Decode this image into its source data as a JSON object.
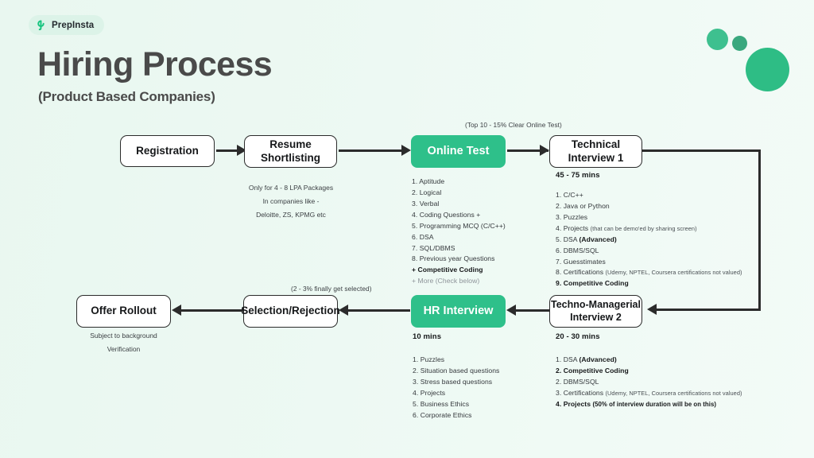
{
  "brand": {
    "logo_icon": "prepinsta-p-logo-icon",
    "name": "PrepInsta"
  },
  "header": {
    "title": "Hiring Process",
    "subtitle": "(Product Based Companies)"
  },
  "colors": {
    "accent_green": "#2ec08a",
    "deco_green_light": "#3ec08f",
    "deco_green_dark": "#3aa87e",
    "background": "#ecf8f2",
    "line": "#2b2b2b"
  },
  "nodes": {
    "registration": {
      "label": "Registration"
    },
    "resume_shortlisting": {
      "label": "Resume\nShortlisting"
    },
    "online_test": {
      "label": "Online Test"
    },
    "technical_interview_1": {
      "label": "Technical\nInterview 1"
    },
    "techno_managerial_interview_2": {
      "label": "Techno-Managerial\nInterview 2"
    },
    "hr_interview": {
      "label": "HR Interview"
    },
    "selection_rejection": {
      "label": "Selection/Rejection"
    },
    "offer_rollout": {
      "label": "Offer Rollout"
    }
  },
  "annotations": {
    "online_test_top": "(Top 10 - 15% Clear Online Test)",
    "selection_top": "(2 - 3% finally get selected)",
    "resume_note_line1": "Only for 4 - 8 LPA Packages",
    "resume_note_line2": "In companies like -",
    "resume_note_line3": "Deloitte, ZS, KPMG etc",
    "offer_note_line1": "Subject to background",
    "offer_note_line2": "Verification"
  },
  "durations": {
    "technical_interview_1": "45 - 75 mins",
    "techno_managerial_interview_2": "20 - 30 mins",
    "hr_interview": "10 mins"
  },
  "lists": {
    "online_test": [
      {
        "text": "1. Aptitude",
        "style": "normal"
      },
      {
        "text": "2. Logical",
        "style": "normal"
      },
      {
        "text": "3. Verbal",
        "style": "normal"
      },
      {
        "text": "4. Coding Questions +",
        "style": "normal"
      },
      {
        "text": "5. Programming MCQ (C/C++)",
        "style": "normal"
      },
      {
        "text": "6. DSA",
        "style": "normal"
      },
      {
        "text": "7. SQL/DBMS",
        "style": "normal"
      },
      {
        "text": "8. Previous year Questions",
        "style": "normal"
      },
      {
        "text": "+ Competitive Coding",
        "style": "bold"
      },
      {
        "text": "+ More (Check below)",
        "style": "muted"
      }
    ],
    "technical_interview_1": [
      {
        "text": "1. C/C++",
        "style": "normal"
      },
      {
        "text": "2. Java or Python",
        "style": "normal"
      },
      {
        "text": "3. Puzzles",
        "style": "normal"
      },
      {
        "text": "4. Projects ",
        "sub": "(that can be demo'ed by sharing screen)",
        "style": "normal"
      },
      {
        "text": "5. DSA ",
        "strong": "(Advanced)",
        "style": "normal"
      },
      {
        "text": "6. DBMS/SQL",
        "style": "normal"
      },
      {
        "text": "7. Guesstimates",
        "style": "normal"
      },
      {
        "text": "8. Certifications ",
        "sub": "(Udemy, NPTEL, Coursera certifications not valued)",
        "style": "normal"
      },
      {
        "text": "9. Competitive Coding",
        "style": "bold"
      }
    ],
    "techno_managerial_interview_2": [
      {
        "text": "1. DSA ",
        "strong": "(Advanced)",
        "style": "normal"
      },
      {
        "text": "2. Competitive Coding",
        "style": "bold"
      },
      {
        "text": "2. DBMS/SQL",
        "style": "normal"
      },
      {
        "text": "3. Certifications ",
        "sub": "(Udemy, NPTEL, Coursera certifications not valued)",
        "style": "normal"
      },
      {
        "text": "4. Projects ",
        "sub": "(50% of interview duration will be on this)",
        "style": "bold"
      }
    ],
    "hr_interview": [
      {
        "text": "1. Puzzles",
        "style": "normal"
      },
      {
        "text": "2. Situation based questions",
        "style": "normal"
      },
      {
        "text": "3. Stress based questions",
        "style": "normal"
      },
      {
        "text": "4. Projects",
        "style": "normal"
      },
      {
        "text": "5. Business Ethics",
        "style": "normal"
      },
      {
        "text": "6. Corporate Ethics",
        "style": "normal"
      }
    ]
  }
}
